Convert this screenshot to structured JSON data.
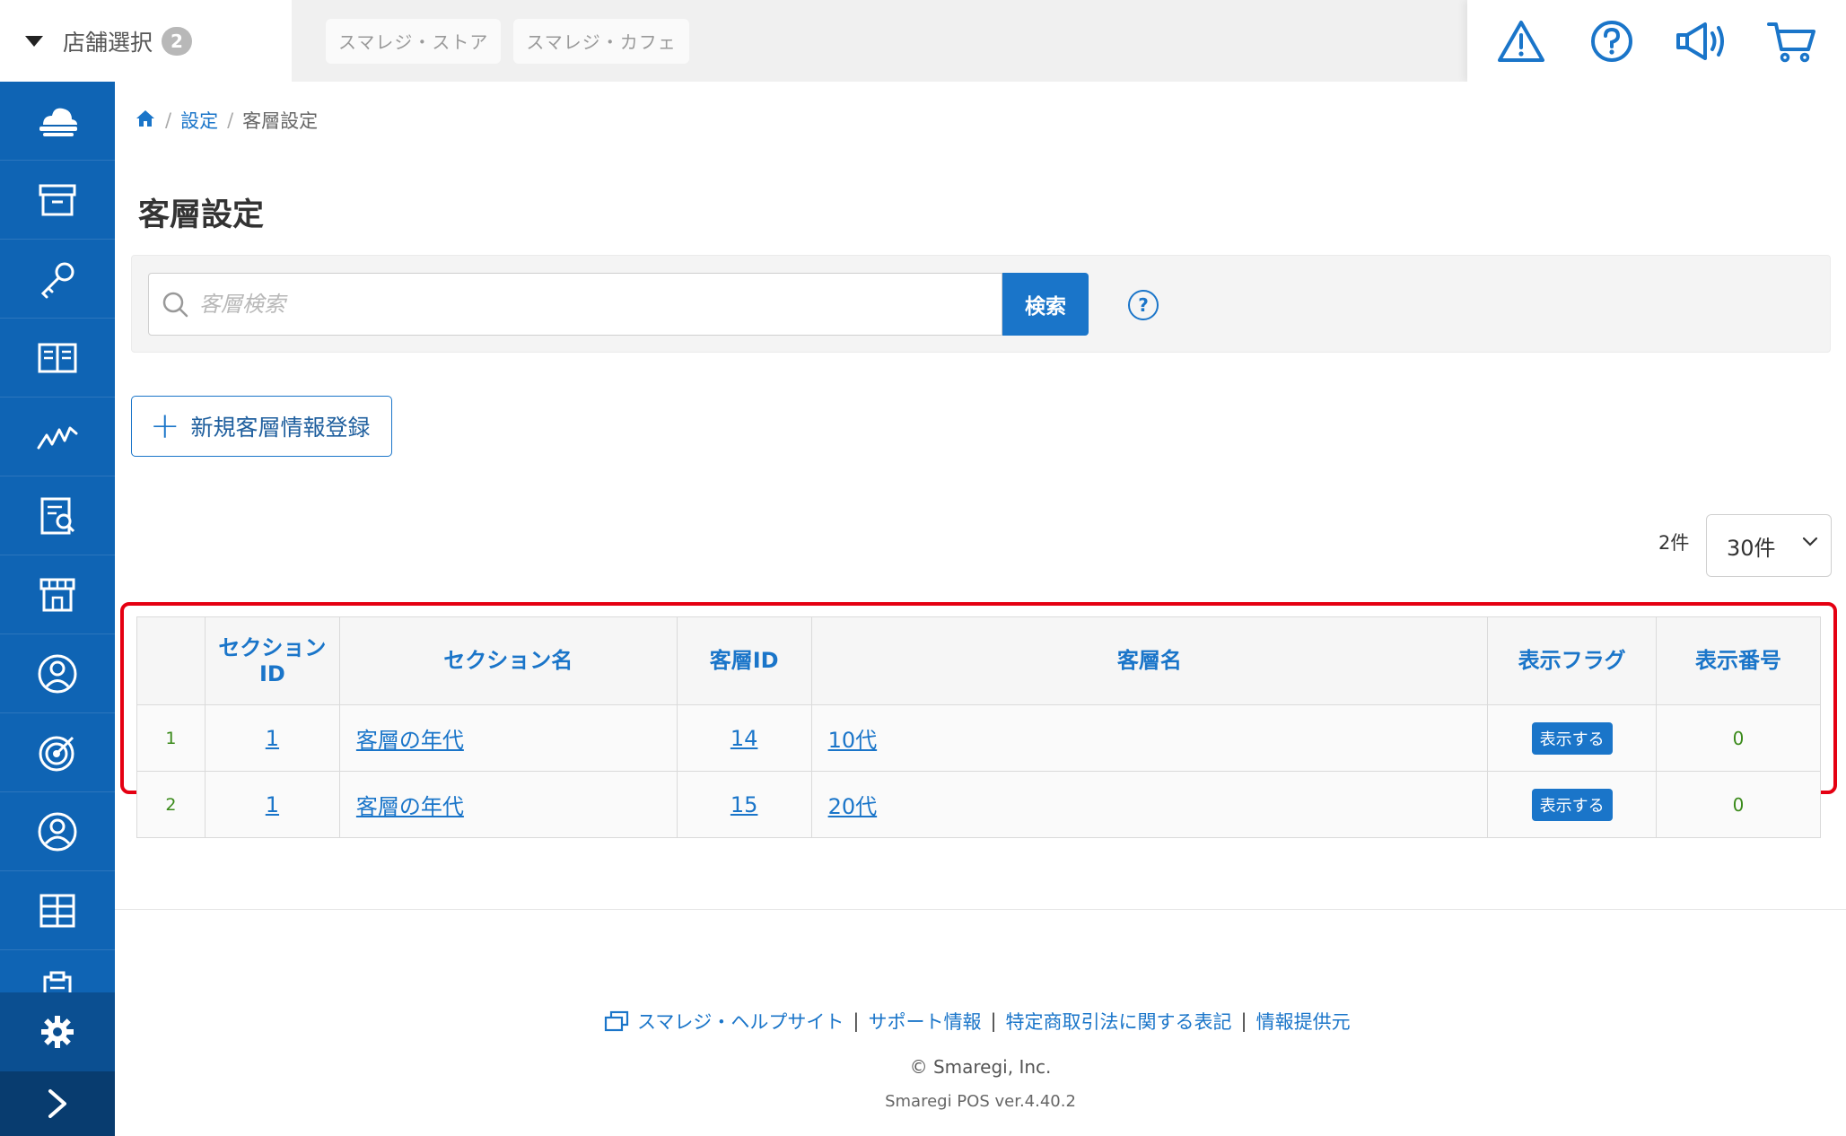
{
  "header": {
    "store_select_label": "店舗選択",
    "store_count": "2",
    "store_tabs": [
      "スマレジ・ストア",
      "スマレジ・カフェ"
    ],
    "icons": [
      "warning-icon",
      "help-icon",
      "megaphone-icon",
      "cart-icon"
    ]
  },
  "sidebar": {
    "items": [
      "cloud-icon",
      "archive-icon",
      "key-icon",
      "book-icon",
      "chart-line-icon",
      "report-icon",
      "store-icon",
      "customer-icon",
      "target-icon",
      "user-icon",
      "grid-icon",
      "clipboard-icon"
    ],
    "settings": "gear-icon",
    "expand": "chevron-right-icon"
  },
  "breadcrumb": {
    "home": "home-icon",
    "settings": "設定",
    "current": "客層設定"
  },
  "page": {
    "title": "客層設定"
  },
  "search": {
    "placeholder": "客層検索",
    "value": "",
    "button": "検索",
    "help": "?"
  },
  "new_button": {
    "plus": "+",
    "label": "新規客層情報登録"
  },
  "pagination": {
    "count": "2件",
    "per_page": "30件"
  },
  "table": {
    "headers": [
      "",
      "セクション\nID",
      "セクション名",
      "客層ID",
      "客層名",
      "表示フラグ",
      "表示番号"
    ],
    "rows": [
      {
        "no": "1",
        "section_id": "1",
        "section_name": "客層の年代",
        "id": "14",
        "name": "10代",
        "flag": "表示する",
        "order": "0"
      },
      {
        "no": "2",
        "section_id": "1",
        "section_name": "客層の年代",
        "id": "15",
        "name": "20代",
        "flag": "表示する",
        "order": "0"
      }
    ]
  },
  "footer": {
    "links": [
      "スマレジ・ヘルプサイト",
      "サポート情報",
      "特定商取引法に関する表記",
      "情報提供元"
    ],
    "separator": "|",
    "copyright": "© Smaregi, Inc.",
    "version": "Smaregi POS ver.4.40.2"
  },
  "colors": {
    "primary": "#1a75c9",
    "sidebar": "#0f64b4",
    "highlight": "#e50012",
    "number_green": "#3a8a1a"
  }
}
